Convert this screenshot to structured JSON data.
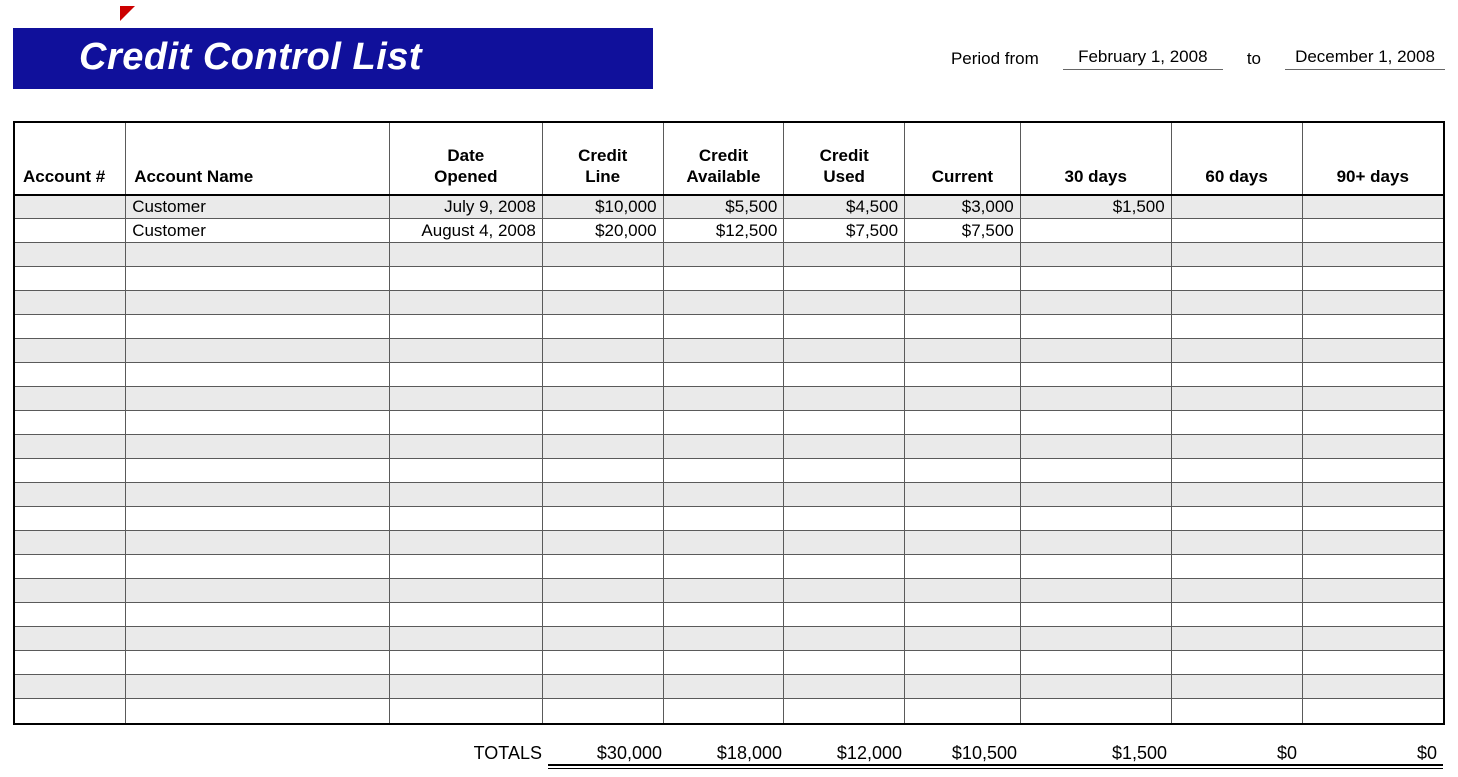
{
  "header": {
    "title": "Credit Control List",
    "period_from_label": "Period from",
    "period_from_value": "February 1, 2008",
    "period_to_label": "to",
    "period_to_value": "December 1, 2008"
  },
  "columns": {
    "account_no": "Account #",
    "account_name": "Account Name",
    "date_opened_l1": "Date",
    "date_opened_l2": "Opened",
    "credit_line_l1": "Credit",
    "credit_line_l2": "Line",
    "credit_avail_l1": "Credit",
    "credit_avail_l2": "Available",
    "credit_used_l1": "Credit",
    "credit_used_l2": "Used",
    "current": "Current",
    "d30": "30 days",
    "d60": "60 days",
    "d90": "90+ days"
  },
  "rows": [
    {
      "account_no": "",
      "account_name": "Customer",
      "date_opened": "July 9, 2008",
      "credit_line": "$10,000",
      "credit_available": "$5,500",
      "credit_used": "$4,500",
      "current": "$3,000",
      "d30": "$1,500",
      "d60": "",
      "d90": ""
    },
    {
      "account_no": "",
      "account_name": "Customer",
      "date_opened": "August 4, 2008",
      "credit_line": "$20,000",
      "credit_available": "$12,500",
      "credit_used": "$7,500",
      "current": "$7,500",
      "d30": "",
      "d60": "",
      "d90": ""
    },
    {
      "account_no": "",
      "account_name": "",
      "date_opened": "",
      "credit_line": "",
      "credit_available": "",
      "credit_used": "",
      "current": "",
      "d30": "",
      "d60": "",
      "d90": ""
    },
    {
      "account_no": "",
      "account_name": "",
      "date_opened": "",
      "credit_line": "",
      "credit_available": "",
      "credit_used": "",
      "current": "",
      "d30": "",
      "d60": "",
      "d90": ""
    },
    {
      "account_no": "",
      "account_name": "",
      "date_opened": "",
      "credit_line": "",
      "credit_available": "",
      "credit_used": "",
      "current": "",
      "d30": "",
      "d60": "",
      "d90": ""
    },
    {
      "account_no": "",
      "account_name": "",
      "date_opened": "",
      "credit_line": "",
      "credit_available": "",
      "credit_used": "",
      "current": "",
      "d30": "",
      "d60": "",
      "d90": ""
    },
    {
      "account_no": "",
      "account_name": "",
      "date_opened": "",
      "credit_line": "",
      "credit_available": "",
      "credit_used": "",
      "current": "",
      "d30": "",
      "d60": "",
      "d90": ""
    },
    {
      "account_no": "",
      "account_name": "",
      "date_opened": "",
      "credit_line": "",
      "credit_available": "",
      "credit_used": "",
      "current": "",
      "d30": "",
      "d60": "",
      "d90": ""
    },
    {
      "account_no": "",
      "account_name": "",
      "date_opened": "",
      "credit_line": "",
      "credit_available": "",
      "credit_used": "",
      "current": "",
      "d30": "",
      "d60": "",
      "d90": ""
    },
    {
      "account_no": "",
      "account_name": "",
      "date_opened": "",
      "credit_line": "",
      "credit_available": "",
      "credit_used": "",
      "current": "",
      "d30": "",
      "d60": "",
      "d90": ""
    },
    {
      "account_no": "",
      "account_name": "",
      "date_opened": "",
      "credit_line": "",
      "credit_available": "",
      "credit_used": "",
      "current": "",
      "d30": "",
      "d60": "",
      "d90": ""
    },
    {
      "account_no": "",
      "account_name": "",
      "date_opened": "",
      "credit_line": "",
      "credit_available": "",
      "credit_used": "",
      "current": "",
      "d30": "",
      "d60": "",
      "d90": ""
    },
    {
      "account_no": "",
      "account_name": "",
      "date_opened": "",
      "credit_line": "",
      "credit_available": "",
      "credit_used": "",
      "current": "",
      "d30": "",
      "d60": "",
      "d90": ""
    },
    {
      "account_no": "",
      "account_name": "",
      "date_opened": "",
      "credit_line": "",
      "credit_available": "",
      "credit_used": "",
      "current": "",
      "d30": "",
      "d60": "",
      "d90": ""
    },
    {
      "account_no": "",
      "account_name": "",
      "date_opened": "",
      "credit_line": "",
      "credit_available": "",
      "credit_used": "",
      "current": "",
      "d30": "",
      "d60": "",
      "d90": ""
    },
    {
      "account_no": "",
      "account_name": "",
      "date_opened": "",
      "credit_line": "",
      "credit_available": "",
      "credit_used": "",
      "current": "",
      "d30": "",
      "d60": "",
      "d90": ""
    },
    {
      "account_no": "",
      "account_name": "",
      "date_opened": "",
      "credit_line": "",
      "credit_available": "",
      "credit_used": "",
      "current": "",
      "d30": "",
      "d60": "",
      "d90": ""
    },
    {
      "account_no": "",
      "account_name": "",
      "date_opened": "",
      "credit_line": "",
      "credit_available": "",
      "credit_used": "",
      "current": "",
      "d30": "",
      "d60": "",
      "d90": ""
    },
    {
      "account_no": "",
      "account_name": "",
      "date_opened": "",
      "credit_line": "",
      "credit_available": "",
      "credit_used": "",
      "current": "",
      "d30": "",
      "d60": "",
      "d90": ""
    },
    {
      "account_no": "",
      "account_name": "",
      "date_opened": "",
      "credit_line": "",
      "credit_available": "",
      "credit_used": "",
      "current": "",
      "d30": "",
      "d60": "",
      "d90": ""
    },
    {
      "account_no": "",
      "account_name": "",
      "date_opened": "",
      "credit_line": "",
      "credit_available": "",
      "credit_used": "",
      "current": "",
      "d30": "",
      "d60": "",
      "d90": ""
    },
    {
      "account_no": "",
      "account_name": "",
      "date_opened": "",
      "credit_line": "",
      "credit_available": "",
      "credit_used": "",
      "current": "",
      "d30": "",
      "d60": "",
      "d90": ""
    }
  ],
  "totals": {
    "label": "TOTALS",
    "credit_line": "$30,000",
    "credit_available": "$18,000",
    "credit_used": "$12,000",
    "current": "$10,500",
    "d30": "$1,500",
    "d60": "$0",
    "d90": "$0"
  }
}
